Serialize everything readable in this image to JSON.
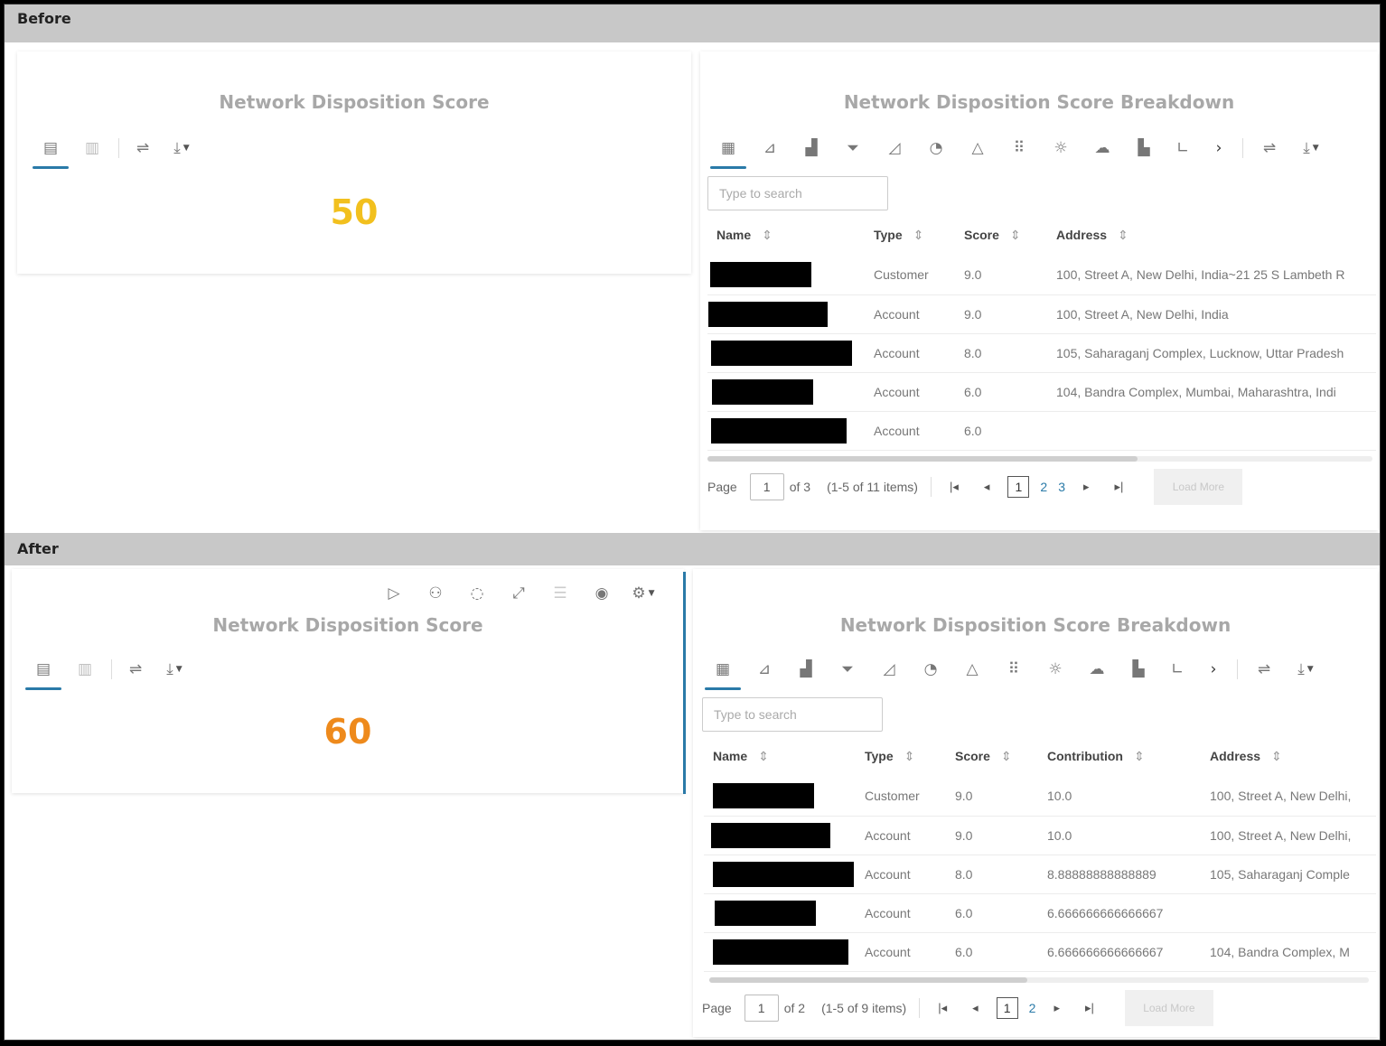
{
  "before": {
    "section_label": "Before",
    "score_card": {
      "title": "Network Disposition Score",
      "value": "50",
      "value_color": "#f2c01e"
    },
    "breakdown": {
      "title": "Network Disposition Score Breakdown",
      "search_placeholder": "Type to search",
      "columns": [
        "Name",
        "Type",
        "Score",
        "Address"
      ],
      "rows": [
        {
          "type": "Customer",
          "score": "9.0",
          "address": "100, Street A, New Delhi, India~21 25 S Lambeth R"
        },
        {
          "type": "Account",
          "score": "9.0",
          "address": "100, Street A, New Delhi, India"
        },
        {
          "type": "Account",
          "score": "8.0",
          "address": "105, Saharaganj Complex, Lucknow, Uttar Pradesh"
        },
        {
          "type": "Account",
          "score": "6.0",
          "address": "104, Bandra Complex, Mumbai, Maharashtra, Indi"
        },
        {
          "type": "Account",
          "score": "6.0",
          "address": ""
        }
      ],
      "pager": {
        "page_label": "Page",
        "page_value": "1",
        "of_label": "of 3",
        "items_label": "(1-5 of 11 items)",
        "pages": [
          "1",
          "2",
          "3"
        ],
        "load_more": "Load More"
      }
    }
  },
  "after": {
    "section_label": "After",
    "score_card": {
      "title": "Network Disposition Score",
      "value": "60",
      "value_color": "#ee8a1c"
    },
    "breakdown": {
      "title": "Network Disposition Score Breakdown",
      "search_placeholder": "Type to search",
      "columns": [
        "Name",
        "Type",
        "Score",
        "Contribution",
        "Address"
      ],
      "rows": [
        {
          "type": "Customer",
          "score": "9.0",
          "contribution": "10.0",
          "address": "100, Street A, New Delhi,"
        },
        {
          "type": "Account",
          "score": "9.0",
          "contribution": "10.0",
          "address": "100, Street A, New Delhi,"
        },
        {
          "type": "Account",
          "score": "8.0",
          "contribution": "8.88888888888889",
          "address": "105, Saharaganj Comple"
        },
        {
          "type": "Account",
          "score": "6.0",
          "contribution": "6.666666666666667",
          "address": ""
        },
        {
          "type": "Account",
          "score": "6.0",
          "contribution": "6.666666666666667",
          "address": "104, Bandra Complex, M"
        }
      ],
      "pager": {
        "page_label": "Page",
        "page_value": "1",
        "of_label": "of 2",
        "items_label": "(1-5 of 9 items)",
        "pages": [
          "1",
          "2"
        ],
        "load_more": "Load More"
      }
    }
  },
  "icons": {
    "score_toolbar": [
      "report-icon",
      "report-alt-icon",
      "sliders-icon",
      "download-icon"
    ],
    "breakdown_toolbar": [
      "table-icon",
      "line-chart-icon",
      "bar-chart-icon",
      "funnel-icon",
      "area-chart-icon",
      "pie-icon",
      "triangle-icon",
      "dots-grid-icon",
      "sun-icon",
      "cloud-icon",
      "combo-chart-icon",
      "axis-icon",
      "chevron-right-icon",
      "sliders-icon",
      "download-icon"
    ],
    "after_header_toolbar": [
      "play-icon",
      "hierarchy-icon",
      "chat-icon",
      "expand-icon",
      "list-icon",
      "eye-icon",
      "gear-icon"
    ]
  },
  "accent_color": "#2a7aa8"
}
